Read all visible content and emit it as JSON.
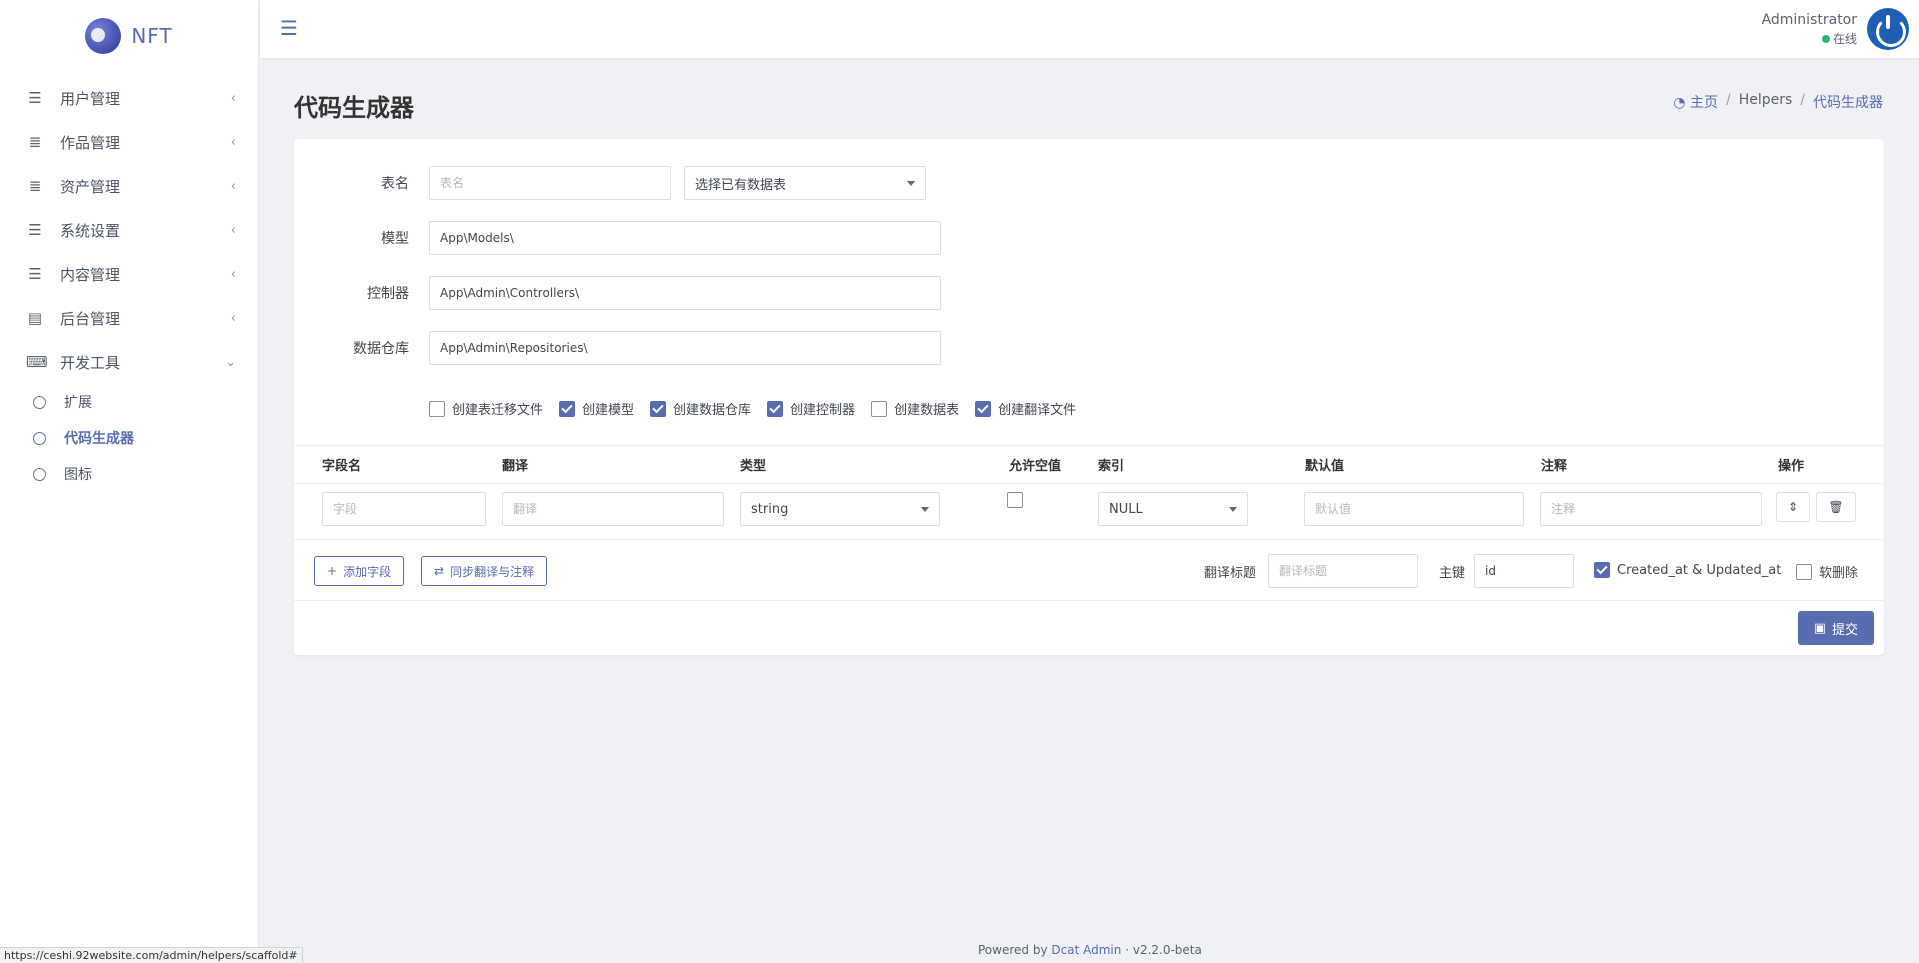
{
  "brand": {
    "name": "NFT"
  },
  "sidebar": {
    "items": [
      {
        "label": "用户管理",
        "icon": "bars-icon"
      },
      {
        "label": "作品管理",
        "icon": "list-icon"
      },
      {
        "label": "资产管理",
        "icon": "list-icon"
      },
      {
        "label": "系统设置",
        "icon": "bars-icon"
      },
      {
        "label": "内容管理",
        "icon": "bars-icon"
      },
      {
        "label": "后台管理",
        "icon": "server-icon"
      },
      {
        "label": "开发工具",
        "icon": "keyboard-icon"
      }
    ],
    "sub_items": [
      {
        "label": "扩展"
      },
      {
        "label": "代码生成器"
      },
      {
        "label": "图标"
      }
    ]
  },
  "header": {
    "user_name": "Administrator",
    "user_status": "在线"
  },
  "page": {
    "title": "代码生成器",
    "breadcrumb": [
      "主页",
      "Helpers",
      "代码生成器"
    ]
  },
  "form": {
    "table_label": "表名",
    "table_placeholder": "表名",
    "table_select": "选择已有数据表",
    "model_label": "模型",
    "model_value": "App\\Models\\",
    "controller_label": "控制器",
    "controller_value": "App\\Admin\\Controllers\\",
    "repository_label": "数据仓库",
    "repository_value": "App\\Admin\\Repositories\\",
    "options": [
      {
        "label": "创建表迁移文件",
        "checked": false
      },
      {
        "label": "创建模型",
        "checked": true
      },
      {
        "label": "创建数据仓库",
        "checked": true
      },
      {
        "label": "创建控制器",
        "checked": true
      },
      {
        "label": "创建数据表",
        "checked": false
      },
      {
        "label": "创建翻译文件",
        "checked": true
      }
    ]
  },
  "fields_table": {
    "headers": [
      "字段名",
      "翻译",
      "类型",
      "允许空值",
      "索引",
      "默认值",
      "注释",
      "操作"
    ],
    "row": {
      "field_placeholder": "字段",
      "translation_placeholder": "翻译",
      "type_value": "string",
      "nullable": false,
      "index_value": "NULL",
      "default_placeholder": "默认值",
      "comment_placeholder": "注释"
    }
  },
  "actions": {
    "add_field": "添加字段",
    "sync_translation": "同步翻译与注释",
    "translation_title_label": "翻译标题",
    "translation_title_placeholder": "翻译标题",
    "primary_key_label": "主键",
    "primary_key_value": "id",
    "timestamps_label": "Created_at & Updated_at",
    "timestamps_checked": true,
    "soft_delete_label": "软删除",
    "soft_delete_checked": false,
    "submit": "提交"
  },
  "footer": {
    "powered_by": "Powered by",
    "brand_link": "Dcat Admin",
    "separator": "·",
    "version": "v2.2.0-beta"
  },
  "statusbar": {
    "url": "https://ceshi.92website.com/admin/helpers/scaffold#"
  },
  "colors": {
    "accent": "#586cb1",
    "online": "#21b978",
    "background": "#eff1f5"
  }
}
